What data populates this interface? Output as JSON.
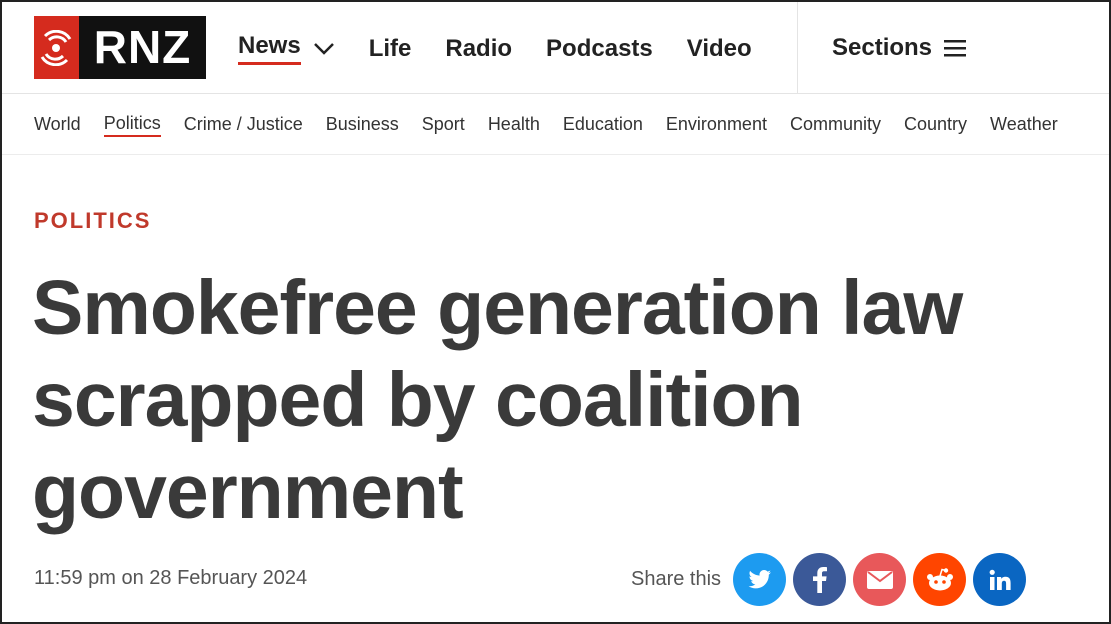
{
  "brand": {
    "name": "RNZ",
    "accent": "#d52b1e"
  },
  "mainnav": {
    "items": [
      {
        "label": "News",
        "active": true,
        "has_dropdown": true
      },
      {
        "label": "Life"
      },
      {
        "label": "Radio"
      },
      {
        "label": "Podcasts"
      },
      {
        "label": "Video"
      }
    ],
    "sections_label": "Sections"
  },
  "subnav": {
    "items": [
      {
        "label": "World"
      },
      {
        "label": "Politics",
        "active": true
      },
      {
        "label": "Crime / Justice"
      },
      {
        "label": "Business"
      },
      {
        "label": "Sport"
      },
      {
        "label": "Health"
      },
      {
        "label": "Education"
      },
      {
        "label": "Environment"
      },
      {
        "label": "Community"
      },
      {
        "label": "Country"
      },
      {
        "label": "Weather"
      }
    ]
  },
  "article": {
    "kicker": "POLITICS",
    "headline": "Smokefree generation law scrapped by coalition government",
    "dateline": "11:59 pm on 28 February 2024"
  },
  "share": {
    "label": "Share this",
    "buttons": [
      {
        "icon": "twitter-icon",
        "color": "#1d9bf0"
      },
      {
        "icon": "facebook-icon",
        "color": "#3b5998"
      },
      {
        "icon": "email-icon",
        "color": "#e8585a"
      },
      {
        "icon": "reddit-icon",
        "color": "#ff4500"
      },
      {
        "icon": "linkedin-icon",
        "color": "#0a66c2"
      }
    ]
  }
}
